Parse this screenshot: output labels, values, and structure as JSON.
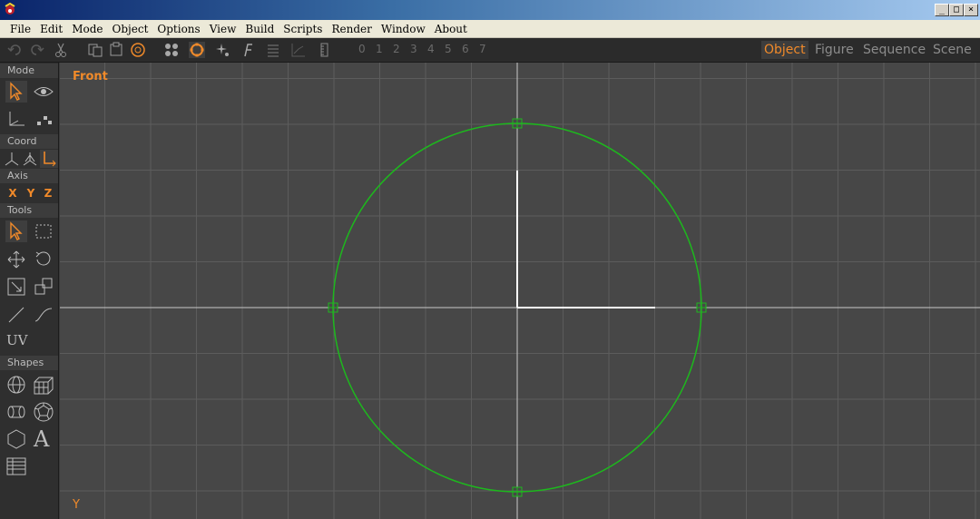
{
  "window": {
    "title": ""
  },
  "menu": [
    "File",
    "Edit",
    "Mode",
    "Object",
    "Options",
    "View",
    "Build",
    "Scripts",
    "Render",
    "Window",
    "About"
  ],
  "toolbar": {
    "undo": "undo-icon",
    "redo": "redo-icon",
    "cut": "scissors-icon",
    "numbers": [
      "0",
      "1",
      "2",
      "3",
      "4",
      "5",
      "6",
      "7"
    ],
    "tabs": [
      "Object",
      "Figure",
      "Sequence",
      "Scene"
    ],
    "active_tab": "Object"
  },
  "leftpanel": {
    "mode_label": "Mode",
    "coord_label": "Coord",
    "axis_label": "Axis",
    "axes": [
      "X",
      "Y",
      "Z"
    ],
    "tools_label": "Tools",
    "uv_label": "UV",
    "shapes_label": "Shapes",
    "text_shape": "A"
  },
  "viewport": {
    "name": "Front",
    "corner_axis": "Y",
    "grid_color": "#5c5c5c",
    "axis_color": "#c8c8c8",
    "shape_color": "#1db81d",
    "accent": "#f08a2a"
  }
}
